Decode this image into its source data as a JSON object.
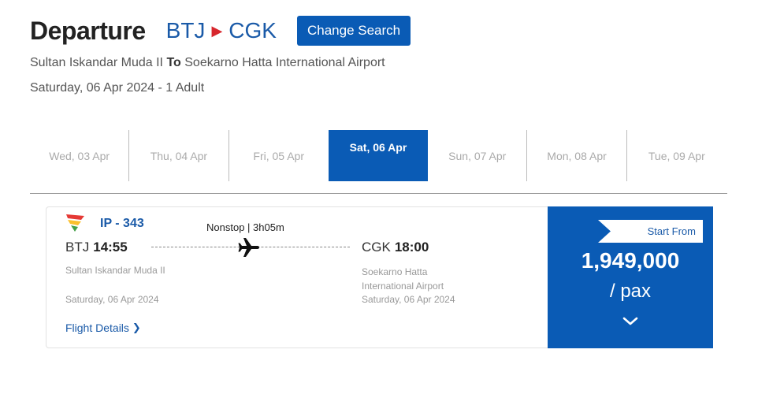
{
  "header": {
    "title": "Departure",
    "origin_code": "BTJ",
    "destination_code": "CGK",
    "change_search_label": "Change Search"
  },
  "route_desc": {
    "origin_name": "Sultan Iskandar Muda II",
    "to_word": "To",
    "destination_name": "Soekarno Hatta International Airport"
  },
  "trip_summary": "Saturday, 06 Apr 2024 - 1 Adult",
  "date_tabs": [
    {
      "label": "Wed, 03 Apr"
    },
    {
      "label": "Thu, 04 Apr"
    },
    {
      "label": "Fri, 05 Apr"
    },
    {
      "label": "Sat, 06 Apr",
      "selected": true
    },
    {
      "label": "Sun, 07 Apr"
    },
    {
      "label": "Mon, 08 Apr"
    },
    {
      "label": "Tue, 09 Apr"
    }
  ],
  "flight": {
    "number": "IP - 343",
    "stops": "Nonstop | 3h05m",
    "departure": {
      "code": "BTJ",
      "time": "14:55",
      "airport": "Sultan Iskandar Muda II",
      "date": "Saturday, 06 Apr 2024"
    },
    "arrival": {
      "code": "CGK",
      "time": "18:00",
      "airport": "Soekarno Hatta International Airport",
      "date": "Saturday, 06 Apr 2024"
    },
    "details_label": "Flight Details",
    "details_icon": "chevron-right-icon"
  },
  "price": {
    "badge": "Start From",
    "amount": "1,949,000",
    "unit": "/ pax",
    "expand_icon": "chevron-down-icon"
  },
  "colors": {
    "primary": "#0a5bb5",
    "link": "#1a5aa8",
    "route_arrow": "#d7262d"
  }
}
